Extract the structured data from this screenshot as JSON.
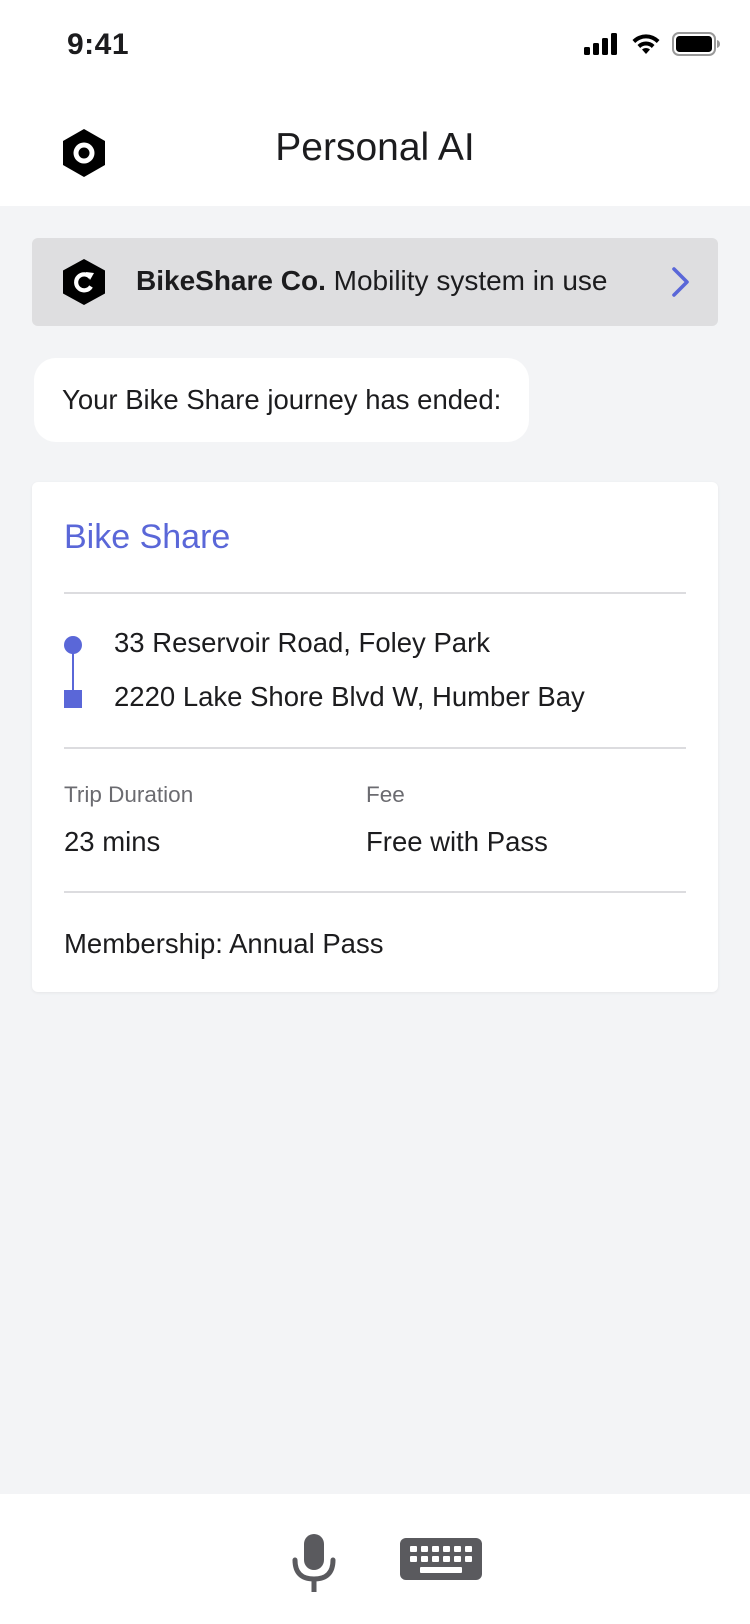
{
  "status_bar": {
    "time": "9:41",
    "icons": [
      "signal-icon",
      "wifi-icon",
      "battery-icon"
    ]
  },
  "header": {
    "title": "Personal AI",
    "logo_icon": "assistant-logo-icon"
  },
  "notice": {
    "brand": "BikeShare Co.",
    "text": " Mobility system in use",
    "logo_icon": "bikeshare-logo-icon",
    "chevron_icon": "chevron-right-icon"
  },
  "message": {
    "text": "Your Bike Share journey has ended:"
  },
  "trip_card": {
    "title": "Bike Share",
    "start_address": "33 Reservoir Road, Foley Park",
    "end_address": "2220 Lake Shore Blvd W, Humber Bay",
    "duration_label": "Trip Duration",
    "duration_value": "23 mins",
    "fee_label": "Fee",
    "fee_value": "Free with Pass",
    "membership": "Membership: Annual Pass"
  },
  "input_bar": {
    "mic_icon": "microphone-icon",
    "keyboard_icon": "keyboard-icon"
  },
  "colors": {
    "accent": "#5a67d8",
    "background": "#f3f4f6",
    "banner": "#dedee0"
  }
}
